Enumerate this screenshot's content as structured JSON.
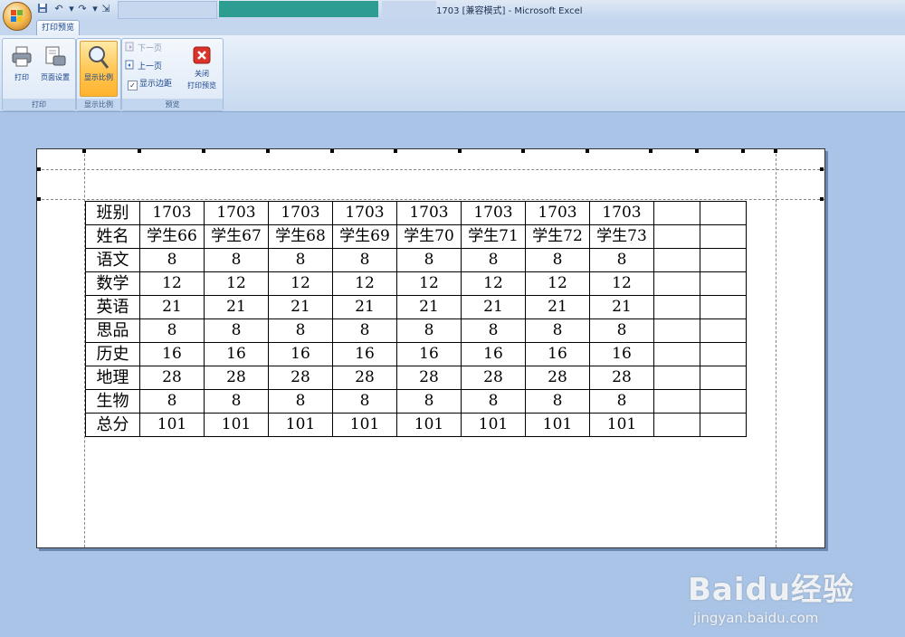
{
  "window": {
    "title": "1703  [兼容模式] - Microsoft Excel",
    "taskbar_items": [
      "",
      "",
      ""
    ]
  },
  "ribbon": {
    "active_tab": "打印预览",
    "groups": {
      "print": {
        "label": "打印",
        "print_button": "打印",
        "page_setup_button": "页面设置"
      },
      "zoom": {
        "label": "显示比例",
        "zoom_button": "显示比例"
      },
      "preview": {
        "label": "预览",
        "next_page": "下一页",
        "prev_page": "上一页",
        "show_margins": "显示边距",
        "show_margins_checked": true,
        "close_button_line1": "关闭",
        "close_button_line2": "打印预览"
      }
    }
  },
  "sheet": {
    "rows": [
      {
        "label": "班别",
        "values": [
          "1703",
          "1703",
          "1703",
          "1703",
          "1703",
          "1703",
          "1703",
          "1703"
        ]
      },
      {
        "label": "姓名",
        "values": [
          "学生66",
          "学生67",
          "学生68",
          "学生69",
          "学生70",
          "学生71",
          "学生72",
          "学生73"
        ]
      },
      {
        "label": "语文",
        "values": [
          "8",
          "8",
          "8",
          "8",
          "8",
          "8",
          "8",
          "8"
        ]
      },
      {
        "label": "数学",
        "values": [
          "12",
          "12",
          "12",
          "12",
          "12",
          "12",
          "12",
          "12"
        ]
      },
      {
        "label": "英语",
        "values": [
          "21",
          "21",
          "21",
          "21",
          "21",
          "21",
          "21",
          "21"
        ]
      },
      {
        "label": "思品",
        "values": [
          "8",
          "8",
          "8",
          "8",
          "8",
          "8",
          "8",
          "8"
        ]
      },
      {
        "label": "历史",
        "values": [
          "16",
          "16",
          "16",
          "16",
          "16",
          "16",
          "16",
          "16"
        ]
      },
      {
        "label": "地理",
        "values": [
          "28",
          "28",
          "28",
          "28",
          "28",
          "28",
          "28",
          "28"
        ]
      },
      {
        "label": "生物",
        "values": [
          "8",
          "8",
          "8",
          "8",
          "8",
          "8",
          "8",
          "8"
        ]
      },
      {
        "label": "总分",
        "values": [
          "101",
          "101",
          "101",
          "101",
          "101",
          "101",
          "101",
          "101"
        ]
      }
    ]
  },
  "watermark": {
    "brand": "Baidu经验",
    "url": "jingyan.baidu.com"
  },
  "colors": {
    "ribbon_active": "#ffc857",
    "workspace": "#a9c4e6",
    "close_red": "#d9332b"
  }
}
